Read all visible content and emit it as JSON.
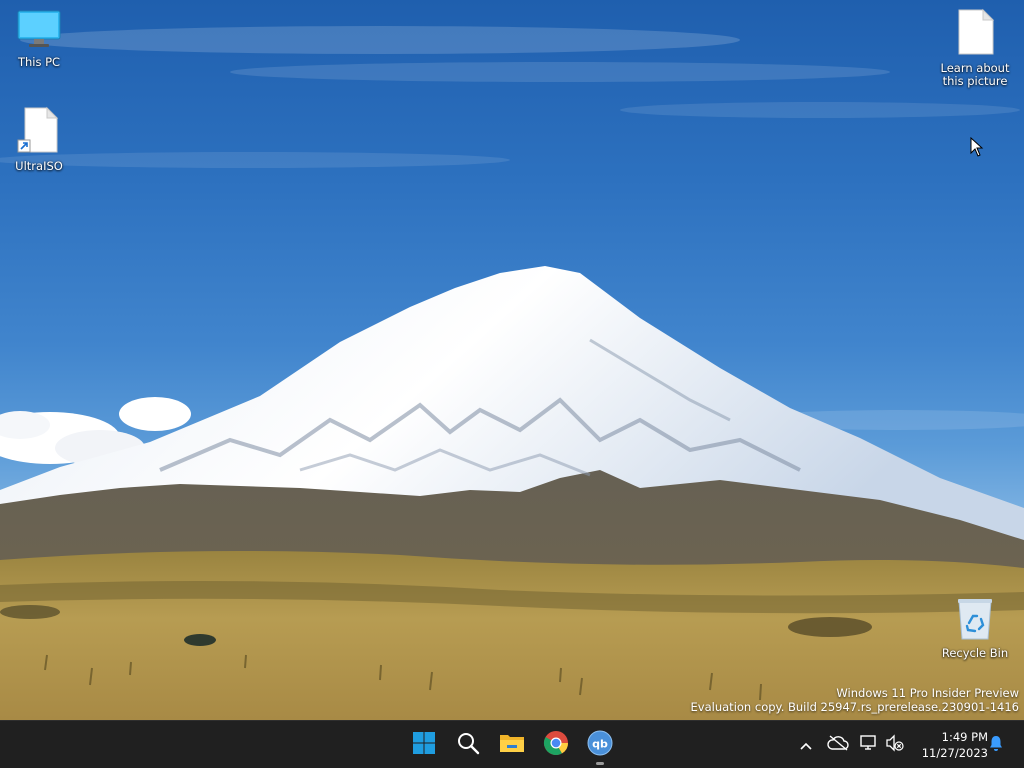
{
  "desktop": {
    "icons": [
      {
        "label": "This PC"
      },
      {
        "label": "UltraISO"
      },
      {
        "label": "Learn about this picture"
      },
      {
        "label": "Recycle Bin"
      }
    ],
    "watermark": {
      "line1": "Windows 11 Pro Insider Preview",
      "line2": "Evaluation copy. Build 25947.rs_prerelease.230901-1416"
    }
  },
  "taskbar": {
    "pinned": [
      {
        "name": "start",
        "icon": "windows-logo-icon"
      },
      {
        "name": "search",
        "icon": "search-icon"
      },
      {
        "name": "file-explorer",
        "icon": "folder-icon"
      },
      {
        "name": "chrome",
        "icon": "chrome-icon"
      },
      {
        "name": "qbittorrent",
        "icon": "qbittorrent-icon",
        "text": "qb",
        "running": true
      }
    ],
    "clock": {
      "time": "1:49 PM",
      "date": "11/27/2023"
    }
  },
  "colors": {
    "taskbar_bg": "#202020",
    "windows_blue": "#1f9de0",
    "notification_bell": "#3a9cff"
  }
}
